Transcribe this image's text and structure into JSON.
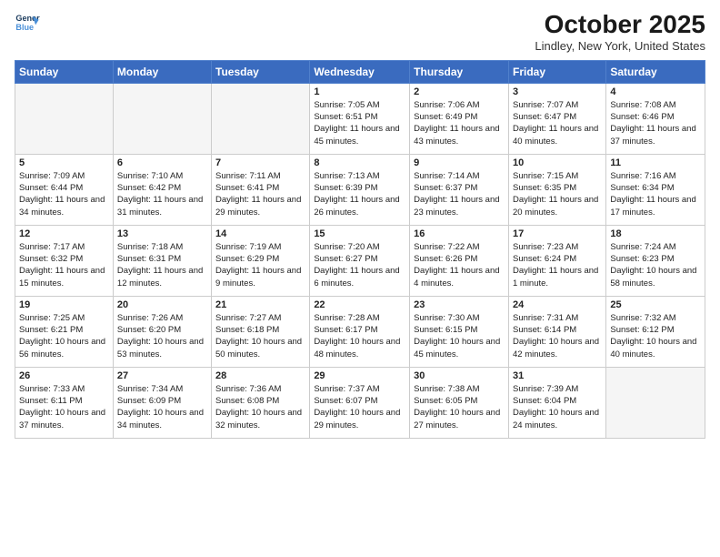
{
  "header": {
    "logo_line1": "General",
    "logo_line2": "Blue",
    "month": "October 2025",
    "location": "Lindley, New York, United States"
  },
  "weekdays": [
    "Sunday",
    "Monday",
    "Tuesday",
    "Wednesday",
    "Thursday",
    "Friday",
    "Saturday"
  ],
  "weeks": [
    [
      {
        "day": "",
        "info": ""
      },
      {
        "day": "",
        "info": ""
      },
      {
        "day": "",
        "info": ""
      },
      {
        "day": "1",
        "info": "Sunrise: 7:05 AM\nSunset: 6:51 PM\nDaylight: 11 hours\nand 45 minutes."
      },
      {
        "day": "2",
        "info": "Sunrise: 7:06 AM\nSunset: 6:49 PM\nDaylight: 11 hours\nand 43 minutes."
      },
      {
        "day": "3",
        "info": "Sunrise: 7:07 AM\nSunset: 6:47 PM\nDaylight: 11 hours\nand 40 minutes."
      },
      {
        "day": "4",
        "info": "Sunrise: 7:08 AM\nSunset: 6:46 PM\nDaylight: 11 hours\nand 37 minutes."
      }
    ],
    [
      {
        "day": "5",
        "info": "Sunrise: 7:09 AM\nSunset: 6:44 PM\nDaylight: 11 hours\nand 34 minutes."
      },
      {
        "day": "6",
        "info": "Sunrise: 7:10 AM\nSunset: 6:42 PM\nDaylight: 11 hours\nand 31 minutes."
      },
      {
        "day": "7",
        "info": "Sunrise: 7:11 AM\nSunset: 6:41 PM\nDaylight: 11 hours\nand 29 minutes."
      },
      {
        "day": "8",
        "info": "Sunrise: 7:13 AM\nSunset: 6:39 PM\nDaylight: 11 hours\nand 26 minutes."
      },
      {
        "day": "9",
        "info": "Sunrise: 7:14 AM\nSunset: 6:37 PM\nDaylight: 11 hours\nand 23 minutes."
      },
      {
        "day": "10",
        "info": "Sunrise: 7:15 AM\nSunset: 6:35 PM\nDaylight: 11 hours\nand 20 minutes."
      },
      {
        "day": "11",
        "info": "Sunrise: 7:16 AM\nSunset: 6:34 PM\nDaylight: 11 hours\nand 17 minutes."
      }
    ],
    [
      {
        "day": "12",
        "info": "Sunrise: 7:17 AM\nSunset: 6:32 PM\nDaylight: 11 hours\nand 15 minutes."
      },
      {
        "day": "13",
        "info": "Sunrise: 7:18 AM\nSunset: 6:31 PM\nDaylight: 11 hours\nand 12 minutes."
      },
      {
        "day": "14",
        "info": "Sunrise: 7:19 AM\nSunset: 6:29 PM\nDaylight: 11 hours\nand 9 minutes."
      },
      {
        "day": "15",
        "info": "Sunrise: 7:20 AM\nSunset: 6:27 PM\nDaylight: 11 hours\nand 6 minutes."
      },
      {
        "day": "16",
        "info": "Sunrise: 7:22 AM\nSunset: 6:26 PM\nDaylight: 11 hours\nand 4 minutes."
      },
      {
        "day": "17",
        "info": "Sunrise: 7:23 AM\nSunset: 6:24 PM\nDaylight: 11 hours\nand 1 minute."
      },
      {
        "day": "18",
        "info": "Sunrise: 7:24 AM\nSunset: 6:23 PM\nDaylight: 10 hours\nand 58 minutes."
      }
    ],
    [
      {
        "day": "19",
        "info": "Sunrise: 7:25 AM\nSunset: 6:21 PM\nDaylight: 10 hours\nand 56 minutes."
      },
      {
        "day": "20",
        "info": "Sunrise: 7:26 AM\nSunset: 6:20 PM\nDaylight: 10 hours\nand 53 minutes."
      },
      {
        "day": "21",
        "info": "Sunrise: 7:27 AM\nSunset: 6:18 PM\nDaylight: 10 hours\nand 50 minutes."
      },
      {
        "day": "22",
        "info": "Sunrise: 7:28 AM\nSunset: 6:17 PM\nDaylight: 10 hours\nand 48 minutes."
      },
      {
        "day": "23",
        "info": "Sunrise: 7:30 AM\nSunset: 6:15 PM\nDaylight: 10 hours\nand 45 minutes."
      },
      {
        "day": "24",
        "info": "Sunrise: 7:31 AM\nSunset: 6:14 PM\nDaylight: 10 hours\nand 42 minutes."
      },
      {
        "day": "25",
        "info": "Sunrise: 7:32 AM\nSunset: 6:12 PM\nDaylight: 10 hours\nand 40 minutes."
      }
    ],
    [
      {
        "day": "26",
        "info": "Sunrise: 7:33 AM\nSunset: 6:11 PM\nDaylight: 10 hours\nand 37 minutes."
      },
      {
        "day": "27",
        "info": "Sunrise: 7:34 AM\nSunset: 6:09 PM\nDaylight: 10 hours\nand 34 minutes."
      },
      {
        "day": "28",
        "info": "Sunrise: 7:36 AM\nSunset: 6:08 PM\nDaylight: 10 hours\nand 32 minutes."
      },
      {
        "day": "29",
        "info": "Sunrise: 7:37 AM\nSunset: 6:07 PM\nDaylight: 10 hours\nand 29 minutes."
      },
      {
        "day": "30",
        "info": "Sunrise: 7:38 AM\nSunset: 6:05 PM\nDaylight: 10 hours\nand 27 minutes."
      },
      {
        "day": "31",
        "info": "Sunrise: 7:39 AM\nSunset: 6:04 PM\nDaylight: 10 hours\nand 24 minutes."
      },
      {
        "day": "",
        "info": ""
      }
    ]
  ]
}
